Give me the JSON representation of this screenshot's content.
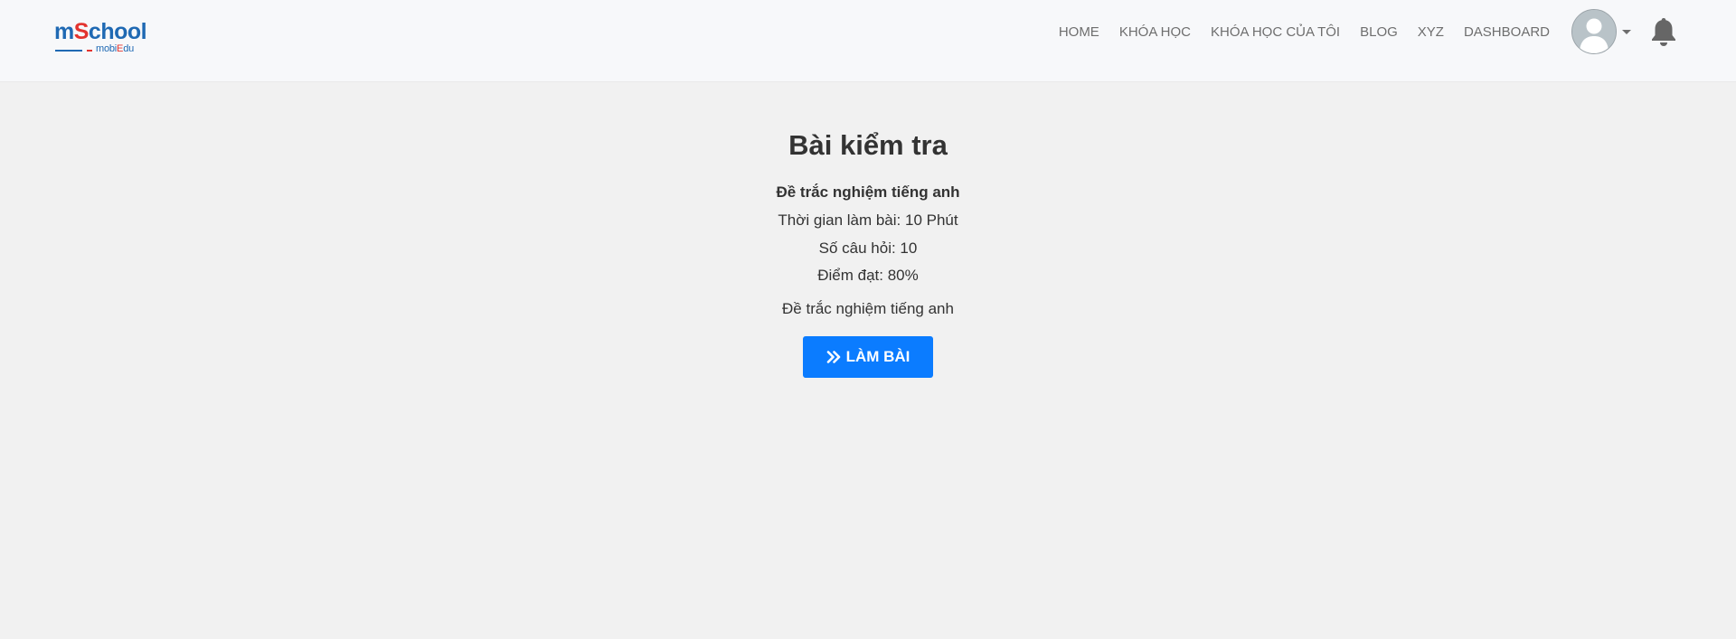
{
  "brand": {
    "logo_main_prefix": "m",
    "logo_main_highlight": "S",
    "logo_main_suffix": "chool",
    "logo_sub_prefix": "mobi",
    "logo_sub_highlight": "E",
    "logo_sub_suffix": "du",
    "colors": {
      "primary": "#1f69b3",
      "accent": "#e3342f"
    }
  },
  "nav": {
    "items": [
      {
        "label": "HOME"
      },
      {
        "label": "KHÓA HỌC"
      },
      {
        "label": "KHÓA HỌC CỦA TÔI"
      },
      {
        "label": "BLOG"
      },
      {
        "label": "XYZ"
      },
      {
        "label": "DASHBOARD"
      }
    ],
    "avatar_icon": "user-avatar-icon",
    "notification_icon": "bell-icon"
  },
  "exam": {
    "page_title": "Bài kiểm tra",
    "name": "Đề trắc nghiệm tiếng anh",
    "duration_text": "Thời gian làm bài: 10 Phút",
    "question_count_text": "Số câu hỏi: 10",
    "pass_score_text": "Điểm đạt: 80%",
    "description": "Đề trắc nghiệm tiếng anh",
    "start_button_label": "LÀM BÀI",
    "start_button_icon": "double-chevron-right-icon",
    "button_color": "#0b7cff"
  }
}
